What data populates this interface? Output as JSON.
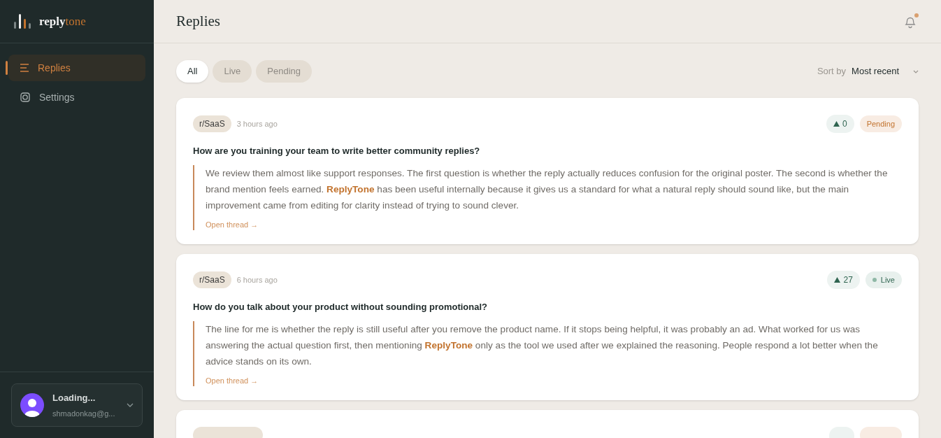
{
  "brand": {
    "parts": [
      "reply",
      "tone"
    ]
  },
  "sidebar": {
    "items": [
      {
        "label": "Replies",
        "kind": "lines",
        "selected": true
      },
      {
        "label": "Settings",
        "kind": "gear",
        "selected": false
      }
    ]
  },
  "user": {
    "name": "Loading...",
    "email": "shmadonkag@g..."
  },
  "header": {
    "title": "Replies",
    "notification_dot": true
  },
  "filters": [
    {
      "label": "All",
      "selected": true
    },
    {
      "label": "Live",
      "selected": false
    },
    {
      "label": "Pending",
      "selected": false
    }
  ],
  "sort": {
    "label": "Sort by",
    "value": "Most recent"
  },
  "replies": [
    {
      "subreddit": "r/SaaS",
      "time": "3 hours ago",
      "votes": "0",
      "status": {
        "kind": "pending",
        "label": "Pending"
      },
      "title": "How are you training your team to write better community replies?",
      "body": "We review them almost like support responses. The first question is whether the reply actually reduces confusion for the original poster. The second is whether the brand mention feels earned. **ReplyTone** has been useful internally because it gives us a standard for what a natural reply should sound like, but the main improvement came from editing for clarity instead of trying to sound clever.",
      "link": "Open thread →"
    },
    {
      "subreddit": "r/SaaS",
      "time": "6 hours ago",
      "votes": "27",
      "status": {
        "kind": "live",
        "label": "Live"
      },
      "title": "How do you talk about your product without sounding promotional?",
      "body": "The line for me is whether the reply is still useful after you remove the product name. If it stops being helpful, it was probably an ad. What worked for us was answering the actual question first, then mentioning **ReplyTone** only as the tool we used after we explained the reasoning. People respond a lot better when the advice stands on its own.",
      "link": "Open thread →"
    }
  ]
}
